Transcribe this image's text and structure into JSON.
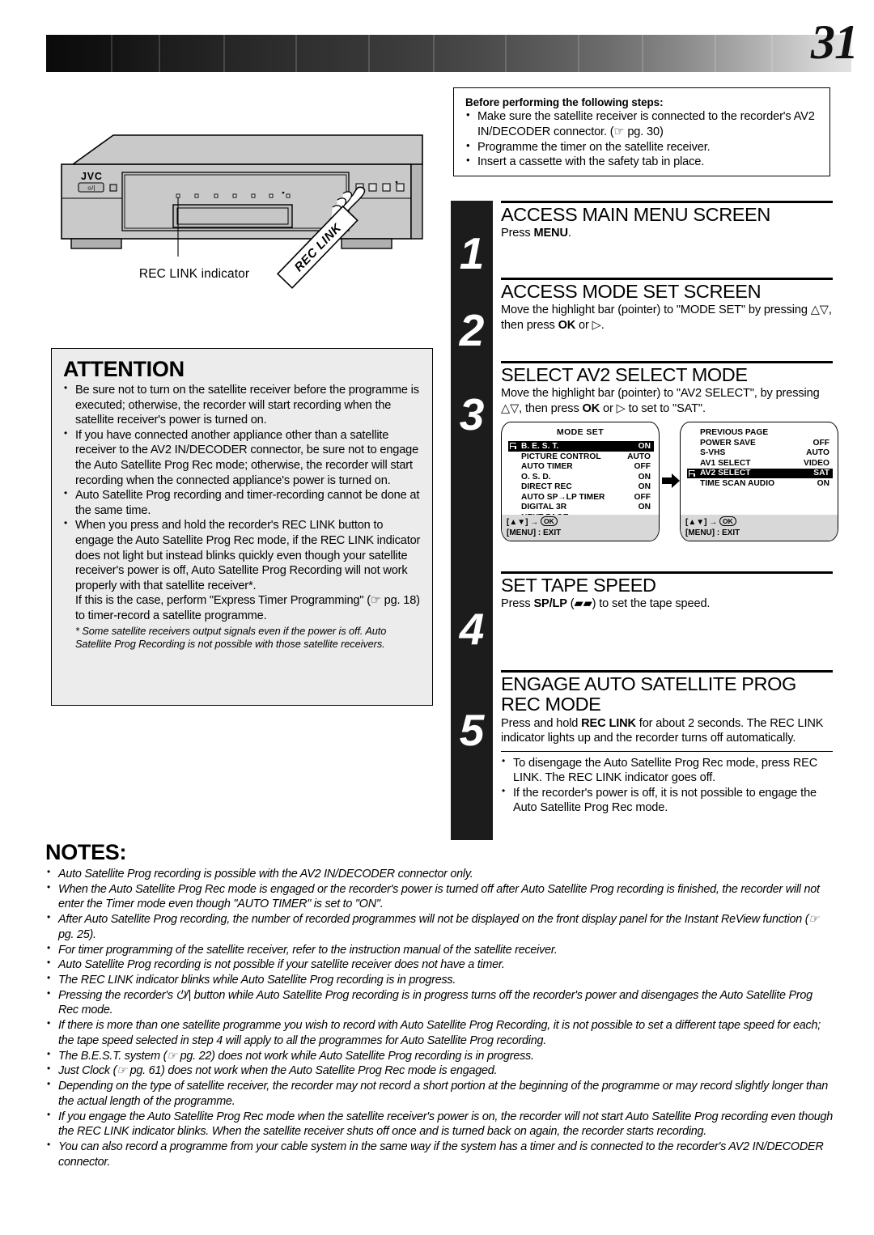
{
  "page": {
    "number": "31"
  },
  "figure": {
    "brand": "JVC",
    "power_button_icon": "power-icon",
    "caption": "REC LINK indicator",
    "callout_label": "REC LINK"
  },
  "prenote": {
    "title": "Before performing the following steps:",
    "items": [
      "Make sure the satellite receiver is connected to the recorder's AV2 IN/DECODER connector. (☞ pg. 30)",
      "Programme the timer on the satellite receiver.",
      "Insert a cassette with the safety tab in place."
    ]
  },
  "attention": {
    "heading": "ATTENTION",
    "items": [
      "Be sure not to turn on the satellite receiver before the programme is executed; otherwise, the recorder will start recording when the satellite receiver's power is turned on.",
      "If you have connected another appliance other than a satellite receiver to the AV2 IN/DECODER connector, be sure not to engage the Auto Satellite Prog Rec mode; otherwise, the recorder will start recording when the connected appliance's power is turned on.",
      "Auto Satellite Prog recording and timer-recording cannot be done at the same time.",
      "When you press and hold the recorder's REC LINK button to engage the Auto Satellite Prog Rec mode, if the REC LINK indicator does not light but instead blinks quickly even though your satellite receiver's power is off, Auto Satellite Prog Recording will not work properly with that satellite receiver*."
    ],
    "last_item_bold": "REC LINK",
    "sub_para": "If this is the case, perform \"Express Timer Programming\" (☞ pg. 18) to timer-record a satellite programme.",
    "footnote": "* Some satellite receivers output signals even if the power is off. Auto Satellite Prog Recording is not possible with those satellite receivers."
  },
  "steps": [
    {
      "number": "1",
      "title": "ACCESS MAIN MENU SCREEN",
      "desc_pre": "Press ",
      "desc_bold": "MENU",
      "desc_post": "."
    },
    {
      "number": "2",
      "title": "ACCESS MODE SET SCREEN",
      "desc_pre": "Move the highlight bar (pointer) to \"MODE SET\" by pressing △▽, then press ",
      "desc_bold": "OK",
      "desc_post": " or ▷."
    },
    {
      "number": "3",
      "title": "SELECT AV2 SELECT MODE",
      "desc_pre": "Move the highlight bar (pointer) to \"AV2 SELECT\", by pressing △▽, then press ",
      "desc_bold": "OK",
      "desc_post": " or ▷ to set to \"SAT\"."
    },
    {
      "number": "4",
      "title": "SET TAPE SPEED",
      "desc_pre": "Press ",
      "desc_bold": "SP/LP",
      "desc_post": " (▰▰) to set the tape speed."
    },
    {
      "number": "5",
      "title": "ENGAGE AUTO SATELLITE PROG REC MODE",
      "desc_pre": "Press and hold ",
      "desc_bold": "REC LINK",
      "desc_post": " for about 2 seconds. The REC LINK indicator lights up and the recorder turns off automatically.",
      "sub_items": [
        "To disengage the Auto Satellite Prog Rec mode, press REC LINK. The REC LINK indicator goes off.",
        "If the recorder's power is off, it is not possible to engage the Auto Satellite Prog Rec mode."
      ]
    }
  ],
  "osd": {
    "left": {
      "title": "MODE SET",
      "rows": [
        {
          "label": "B. E. S. T.",
          "value": "ON",
          "highlighted": true
        },
        {
          "label": "PICTURE CONTROL",
          "value": "AUTO",
          "highlighted": false
        },
        {
          "label": "AUTO TIMER",
          "value": "OFF",
          "highlighted": false
        },
        {
          "label": "O. S. D.",
          "value": "ON",
          "highlighted": false
        },
        {
          "label": "DIRECT REC",
          "value": "ON",
          "highlighted": false
        },
        {
          "label": "AUTO SP→LP TIMER",
          "value": "OFF",
          "highlighted": false
        },
        {
          "label": "DIGITAL 3R",
          "value": "ON",
          "highlighted": false
        },
        {
          "label": "NEXT PAGE",
          "value": "",
          "highlighted": false
        }
      ],
      "footer_line1": "[▲▼] →",
      "footer_ok": "OK",
      "footer_line2": "[MENU] : EXIT"
    },
    "right": {
      "title": "",
      "rows": [
        {
          "label": "PREVIOUS PAGE",
          "value": "",
          "highlighted": false
        },
        {
          "label": "POWER SAVE",
          "value": "OFF",
          "highlighted": false
        },
        {
          "label": "S-VHS",
          "value": "AUTO",
          "highlighted": false
        },
        {
          "label": "AV1 SELECT",
          "value": "VIDEO",
          "highlighted": false
        },
        {
          "label": "AV2 SELECT",
          "value": "SAT",
          "highlighted": true
        },
        {
          "label": "TIME SCAN AUDIO",
          "value": "ON",
          "highlighted": false
        }
      ],
      "footer_line1": "[▲▼] →",
      "footer_ok": "OK",
      "footer_line2": "[MENU] : EXIT"
    }
  },
  "notes": {
    "heading": "NOTES:",
    "items": [
      "Auto Satellite Prog recording is possible with the AV2 IN/DECODER connector only.",
      "When the Auto Satellite Prog Rec mode is engaged or the recorder's power is turned off after Auto Satellite Prog recording is finished, the recorder will not enter the Timer mode even though \"AUTO TIMER\" is set to \"ON\".",
      "After Auto Satellite Prog recording, the number of recorded programmes will not be displayed on the front display panel for the Instant ReView function (☞ pg. 25).",
      "For timer programming of the satellite receiver, refer to the instruction manual of the satellite receiver.",
      "Auto Satellite Prog recording is not possible if your satellite receiver does not have a timer.",
      "The REC LINK indicator blinks while Auto Satellite Prog recording is in progress.",
      "Pressing the recorder's ⏻/| button while Auto Satellite Prog recording is in progress turns off the recorder's power and disengages the Auto Satellite Prog Rec mode.",
      "If there is more than one satellite programme you wish to record with Auto Satellite Prog Recording, it is not possible to set a different tape speed for each; the tape speed selected in step 4 will apply to all the programmes for Auto Satellite Prog recording.",
      "The B.E.S.T. system (☞ pg. 22) does not work while Auto Satellite Prog recording is in progress.",
      "Just Clock (☞ pg. 61) does not work when the Auto Satellite Prog Rec mode is engaged.",
      "Depending on the type of satellite receiver, the recorder may not record a short portion at the beginning of the programme or may record slightly longer than the actual length of the programme.",
      "If you engage the Auto Satellite Prog Rec mode when the satellite receiver's power is on, the recorder will not start Auto Satellite Prog recording even though the REC LINK indicator blinks. When the satellite receiver shuts off once and is turned back on again, the recorder starts recording.",
      "You can also record a programme from your cable system in the same way if the system has a timer and is connected to the recorder's AV2 IN/DECODER connector."
    ]
  }
}
